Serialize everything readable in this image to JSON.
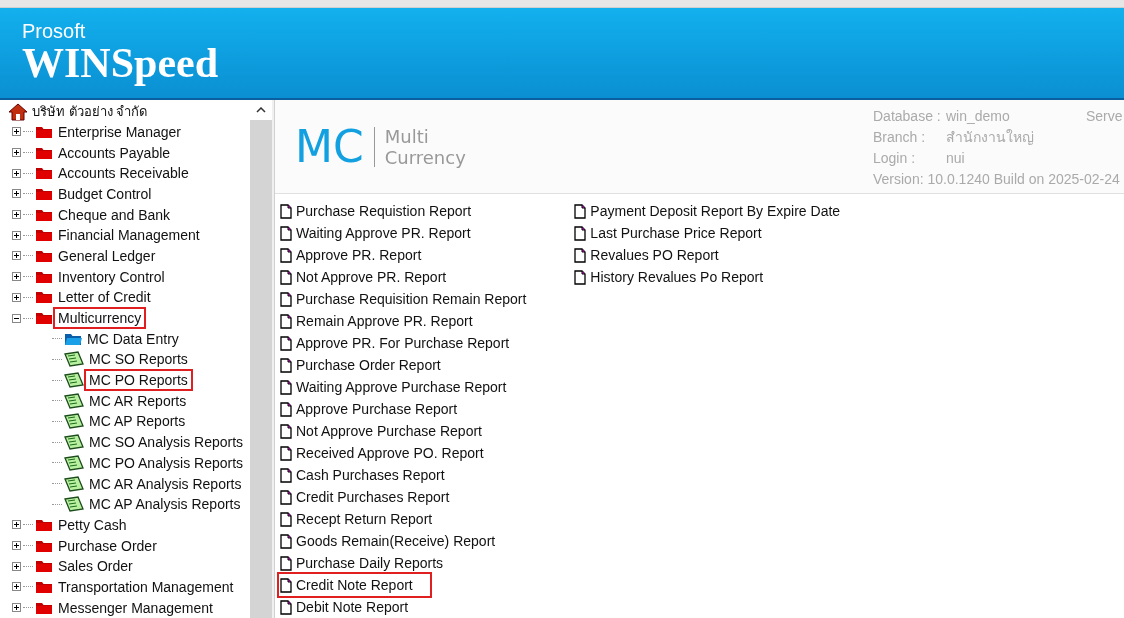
{
  "header": {
    "brand_small": "Prosoft",
    "brand_large": "WINSpeed"
  },
  "tree": {
    "root": {
      "label": "บริษัท ตัวอย่าง จำกัด",
      "children": [
        {
          "label": "Enterprise Manager",
          "kind": "folder",
          "expanded": false,
          "highlighted": false
        },
        {
          "label": "Accounts Payable",
          "kind": "folder",
          "expanded": false,
          "highlighted": false
        },
        {
          "label": "Accounts Receivable",
          "kind": "folder",
          "expanded": false,
          "highlighted": false
        },
        {
          "label": "Budget Control",
          "kind": "folder",
          "expanded": false,
          "highlighted": false
        },
        {
          "label": "Cheque and Bank",
          "kind": "folder",
          "expanded": false,
          "highlighted": false
        },
        {
          "label": "Financial Management",
          "kind": "folder",
          "expanded": false,
          "highlighted": false
        },
        {
          "label": "General Ledger",
          "kind": "folder",
          "expanded": false,
          "highlighted": false
        },
        {
          "label": "Inventory Control",
          "kind": "folder",
          "expanded": false,
          "highlighted": false
        },
        {
          "label": "Letter of Credit",
          "kind": "folder",
          "expanded": false,
          "highlighted": false
        },
        {
          "label": "Multicurrency",
          "kind": "folder",
          "expanded": true,
          "highlighted": true,
          "children": [
            {
              "label": "MC Data Entry",
              "kind": "entry",
              "highlighted": false
            },
            {
              "label": "MC SO Reports",
              "kind": "report",
              "highlighted": false
            },
            {
              "label": "MC PO Reports",
              "kind": "report",
              "highlighted": true
            },
            {
              "label": "MC AR Reports",
              "kind": "report",
              "highlighted": false
            },
            {
              "label": "MC AP Reports",
              "kind": "report",
              "highlighted": false
            },
            {
              "label": "MC SO Analysis Reports",
              "kind": "report",
              "highlighted": false
            },
            {
              "label": "MC PO Analysis Reports",
              "kind": "report",
              "highlighted": false
            },
            {
              "label": "MC AR Analysis Reports",
              "kind": "report",
              "highlighted": false
            },
            {
              "label": "MC AP Analysis Reports",
              "kind": "report",
              "highlighted": false
            }
          ]
        },
        {
          "label": "Petty Cash",
          "kind": "folder",
          "expanded": false,
          "highlighted": false
        },
        {
          "label": "Purchase Order",
          "kind": "folder",
          "expanded": false,
          "highlighted": false
        },
        {
          "label": "Sales Order",
          "kind": "folder",
          "expanded": false,
          "highlighted": false
        },
        {
          "label": "Transportation Management",
          "kind": "folder",
          "expanded": false,
          "highlighted": false
        },
        {
          "label": "Messenger Management",
          "kind": "folder",
          "expanded": false,
          "highlighted": false
        }
      ]
    }
  },
  "module": {
    "code": "MC",
    "name_line1": "Multi",
    "name_line2": "Currency"
  },
  "info": [
    {
      "label": "Database :",
      "value": "win_demo"
    },
    {
      "label": "Branch :",
      "value": "สำนักงานใหญ่"
    },
    {
      "label": "Login :",
      "value": "nui"
    }
  ],
  "info_server": "Serve",
  "version": "Version: 10.0.1240  Build on 2025-02-24",
  "reports": [
    [
      {
        "label": "Purchase Requistion Report",
        "highlighted": false
      },
      {
        "label": "Waiting Approve PR. Report",
        "highlighted": false
      },
      {
        "label": "Approve PR. Report",
        "highlighted": false
      },
      {
        "label": "Not Approve PR. Report",
        "highlighted": false
      },
      {
        "label": "Purchase Requisition Remain Report",
        "highlighted": false
      },
      {
        "label": "Remain Approve PR. Report",
        "highlighted": false
      },
      {
        "label": "Approve PR. For Purchase Report",
        "highlighted": false
      },
      {
        "label": "Purchase Order Report",
        "highlighted": false
      },
      {
        "label": "Waiting Approve Purchase Report",
        "highlighted": false
      },
      {
        "label": "Approve Purchase Report",
        "highlighted": false
      },
      {
        "label": "Not Approve Purchase Report",
        "highlighted": false
      },
      {
        "label": "Received Approve PO. Report",
        "highlighted": false
      },
      {
        "label": "Cash  Purchases Report",
        "highlighted": false
      },
      {
        "label": "Credit Purchases Report",
        "highlighted": false
      },
      {
        "label": "Recept Return Report",
        "highlighted": false
      },
      {
        "label": "Goods Remain(Receive) Report",
        "highlighted": false
      },
      {
        "label": "Purchase Daily Reports",
        "highlighted": false
      },
      {
        "label": "Credit Note Report",
        "highlighted": true
      },
      {
        "label": "Debit Note Report",
        "highlighted": false
      }
    ],
    [
      {
        "label": "Payment Deposit Report By Expire Date",
        "highlighted": false
      },
      {
        "label": "Last Purchase Price Report",
        "highlighted": false
      },
      {
        "label": "Revalues PO Report",
        "highlighted": false
      },
      {
        "label": "History Revalues Po Report",
        "highlighted": false
      }
    ]
  ]
}
